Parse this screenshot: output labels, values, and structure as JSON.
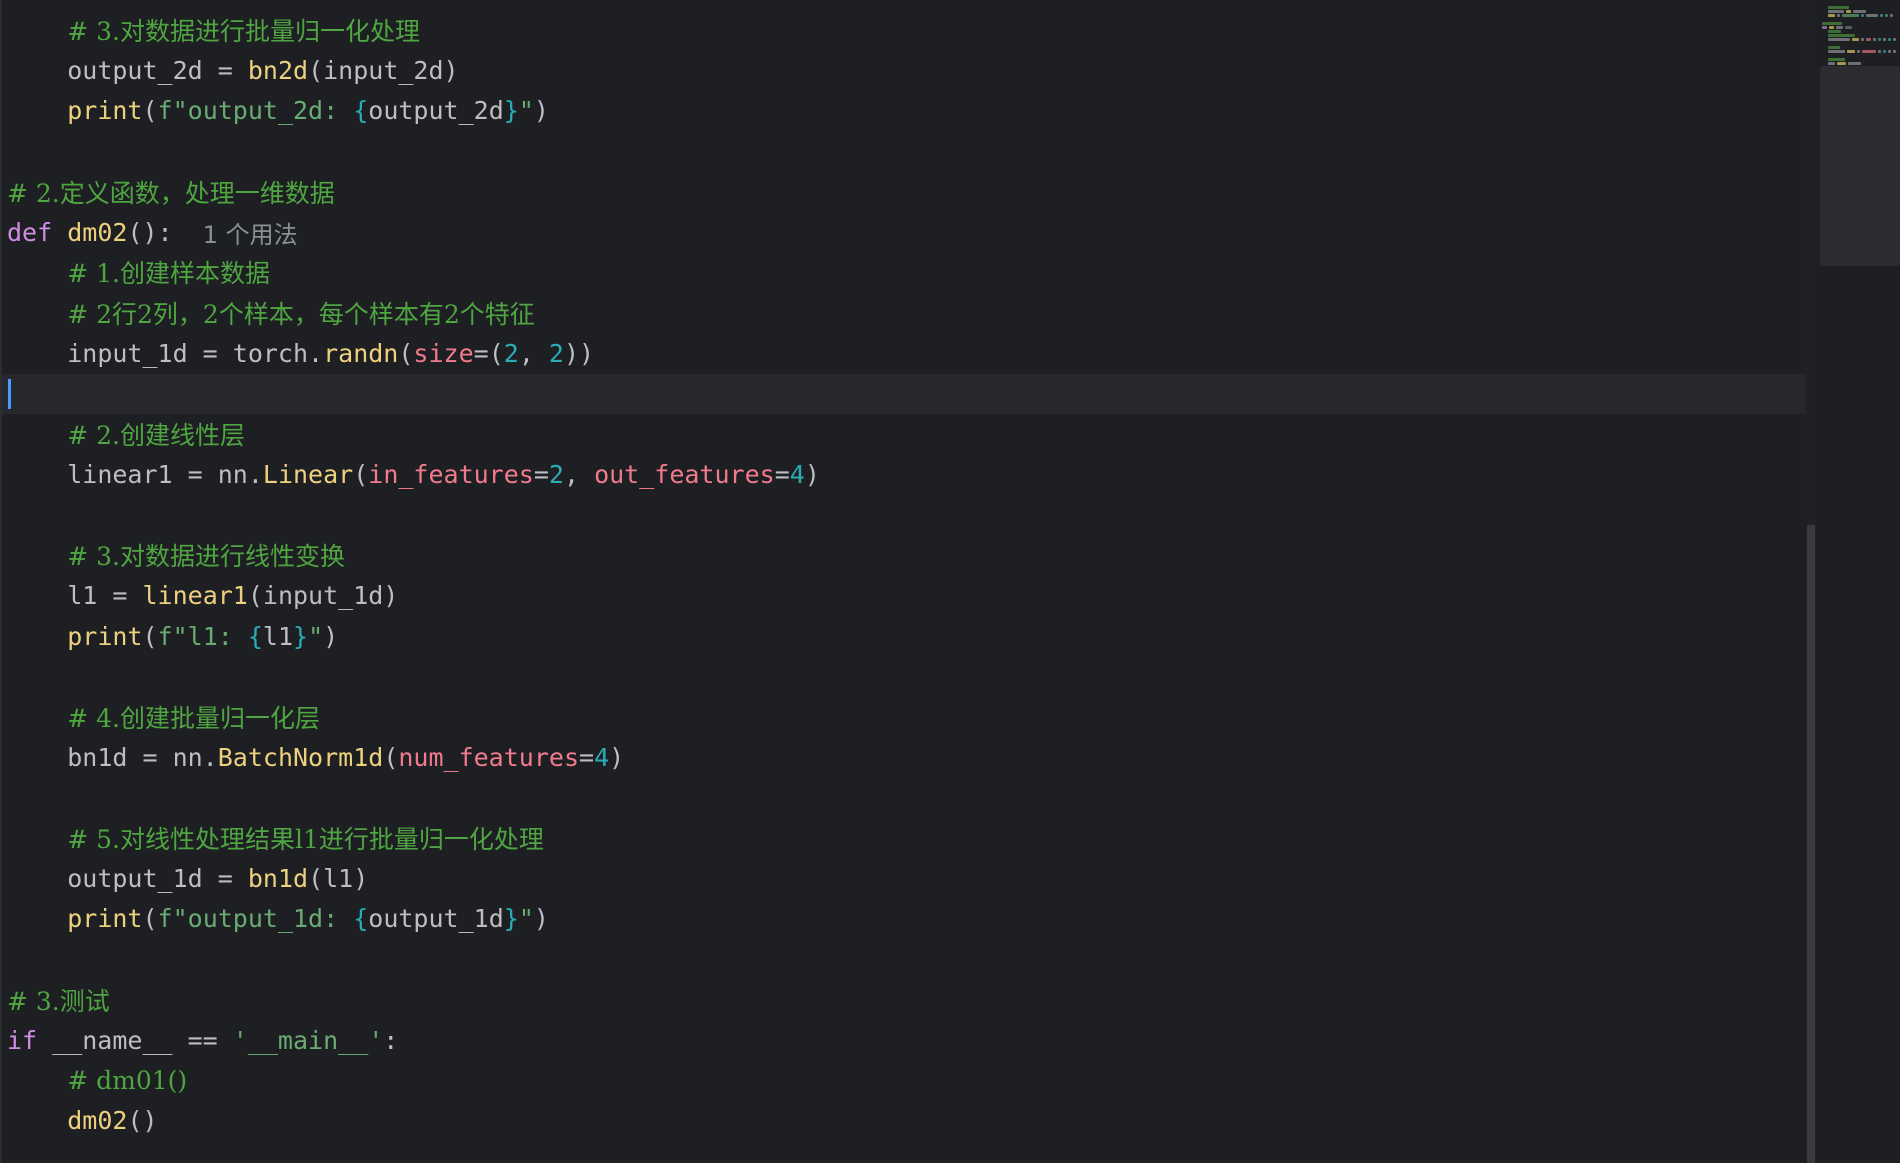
{
  "editor": {
    "lines": [
      {
        "indent": "    ",
        "tokens": [
          {
            "t": "comment",
            "v": "# 3.对数据进行批量归一化处理"
          }
        ]
      },
      {
        "indent": "    ",
        "tokens": [
          {
            "t": "plain",
            "v": "output_2d = "
          },
          {
            "t": "fn",
            "v": "bn2d"
          },
          {
            "t": "plain",
            "v": "(input_2d)"
          }
        ]
      },
      {
        "indent": "    ",
        "tokens": [
          {
            "t": "fn",
            "v": "print"
          },
          {
            "t": "plain",
            "v": "("
          },
          {
            "t": "str",
            "v": "f\"output_2d: "
          },
          {
            "t": "brace",
            "v": "{"
          },
          {
            "t": "plain",
            "v": "output_2d"
          },
          {
            "t": "brace",
            "v": "}"
          },
          {
            "t": "str",
            "v": "\""
          },
          {
            "t": "plain",
            "v": ")"
          }
        ]
      },
      {
        "indent": "",
        "tokens": []
      },
      {
        "indent": "",
        "tokens": [
          {
            "t": "comment",
            "v": "# 2.定义函数，处理一维数据"
          }
        ]
      },
      {
        "indent": "",
        "tokens": [
          {
            "t": "keyword",
            "v": "def "
          },
          {
            "t": "fn",
            "v": "dm02"
          },
          {
            "t": "plain",
            "v": "():  "
          },
          {
            "t": "hint",
            "v": "1 个用法"
          }
        ]
      },
      {
        "indent": "    ",
        "tokens": [
          {
            "t": "comment",
            "v": "# 1.创建样本数据"
          }
        ]
      },
      {
        "indent": "    ",
        "tokens": [
          {
            "t": "comment",
            "v": "# 2行2列，2个样本，每个样本有2个特征"
          }
        ]
      },
      {
        "indent": "    ",
        "tokens": [
          {
            "t": "plain",
            "v": "input_1d = torch."
          },
          {
            "t": "fn",
            "v": "randn"
          },
          {
            "t": "plain",
            "v": "("
          },
          {
            "t": "param",
            "v": "size"
          },
          {
            "t": "plain",
            "v": "=("
          },
          {
            "t": "num",
            "v": "2"
          },
          {
            "t": "plain",
            "v": ", "
          },
          {
            "t": "num",
            "v": "2"
          },
          {
            "t": "plain",
            "v": "))"
          }
        ]
      },
      {
        "indent": "",
        "tokens": [],
        "current": true
      },
      {
        "indent": "    ",
        "tokens": [
          {
            "t": "comment",
            "v": "# 2.创建线性层"
          }
        ]
      },
      {
        "indent": "    ",
        "tokens": [
          {
            "t": "plain",
            "v": "linear1 = nn."
          },
          {
            "t": "fn",
            "v": "Linear"
          },
          {
            "t": "plain",
            "v": "("
          },
          {
            "t": "param",
            "v": "in_features"
          },
          {
            "t": "plain",
            "v": "="
          },
          {
            "t": "num",
            "v": "2"
          },
          {
            "t": "plain",
            "v": ", "
          },
          {
            "t": "param",
            "v": "out_features"
          },
          {
            "t": "plain",
            "v": "="
          },
          {
            "t": "num",
            "v": "4"
          },
          {
            "t": "plain",
            "v": ")"
          }
        ]
      },
      {
        "indent": "",
        "tokens": []
      },
      {
        "indent": "    ",
        "tokens": [
          {
            "t": "comment",
            "v": "# 3.对数据进行线性变换"
          }
        ]
      },
      {
        "indent": "    ",
        "tokens": [
          {
            "t": "plain",
            "v": "l1 = "
          },
          {
            "t": "fn",
            "v": "linear1"
          },
          {
            "t": "plain",
            "v": "(input_1d)"
          }
        ]
      },
      {
        "indent": "    ",
        "tokens": [
          {
            "t": "fn",
            "v": "print"
          },
          {
            "t": "plain",
            "v": "("
          },
          {
            "t": "str",
            "v": "f\"l1: "
          },
          {
            "t": "brace",
            "v": "{"
          },
          {
            "t": "plain",
            "v": "l1"
          },
          {
            "t": "brace",
            "v": "}"
          },
          {
            "t": "str",
            "v": "\""
          },
          {
            "t": "plain",
            "v": ")"
          }
        ]
      },
      {
        "indent": "",
        "tokens": []
      },
      {
        "indent": "    ",
        "tokens": [
          {
            "t": "comment",
            "v": "# 4.创建批量归一化层"
          }
        ]
      },
      {
        "indent": "    ",
        "tokens": [
          {
            "t": "plain",
            "v": "bn1d = nn."
          },
          {
            "t": "fn",
            "v": "BatchNorm1d"
          },
          {
            "t": "plain",
            "v": "("
          },
          {
            "t": "param",
            "v": "num_features"
          },
          {
            "t": "plain",
            "v": "="
          },
          {
            "t": "num",
            "v": "4"
          },
          {
            "t": "plain",
            "v": ")"
          }
        ]
      },
      {
        "indent": "",
        "tokens": []
      },
      {
        "indent": "    ",
        "tokens": [
          {
            "t": "comment",
            "v": "# 5.对线性处理结果l1进行批量归一化处理"
          }
        ]
      },
      {
        "indent": "    ",
        "tokens": [
          {
            "t": "plain",
            "v": "output_1d = "
          },
          {
            "t": "fn",
            "v": "bn1d"
          },
          {
            "t": "plain",
            "v": "(l1)"
          }
        ]
      },
      {
        "indent": "    ",
        "tokens": [
          {
            "t": "fn",
            "v": "print"
          },
          {
            "t": "plain",
            "v": "("
          },
          {
            "t": "str",
            "v": "f\"output_1d: "
          },
          {
            "t": "brace",
            "v": "{"
          },
          {
            "t": "plain",
            "v": "output_1d"
          },
          {
            "t": "brace",
            "v": "}"
          },
          {
            "t": "str",
            "v": "\""
          },
          {
            "t": "plain",
            "v": ")"
          }
        ]
      },
      {
        "indent": "",
        "tokens": []
      },
      {
        "indent": "",
        "tokens": [
          {
            "t": "comment",
            "v": "# 3.测试"
          }
        ]
      },
      {
        "indent": "",
        "tokens": [
          {
            "t": "keyword",
            "v": "if "
          },
          {
            "t": "plain",
            "v": "__name__ == "
          },
          {
            "t": "str",
            "v": "'__main__'"
          },
          {
            "t": "plain",
            "v": ":"
          }
        ]
      },
      {
        "indent": "    ",
        "tokens": [
          {
            "t": "comment",
            "v": "# dm01()"
          }
        ]
      },
      {
        "indent": "    ",
        "tokens": [
          {
            "t": "fn",
            "v": "dm02"
          },
          {
            "t": "plain",
            "v": "()"
          }
        ]
      }
    ]
  },
  "colors": {
    "background": "#1e1f22",
    "comment": "#4fa541",
    "keyword": "#cf8ee4",
    "function": "#eed17e",
    "string": "#6aab73",
    "number": "#2aacb8",
    "parameter": "#f07b8d",
    "plain": "#bcbec4",
    "caret": "#4c9bff"
  }
}
